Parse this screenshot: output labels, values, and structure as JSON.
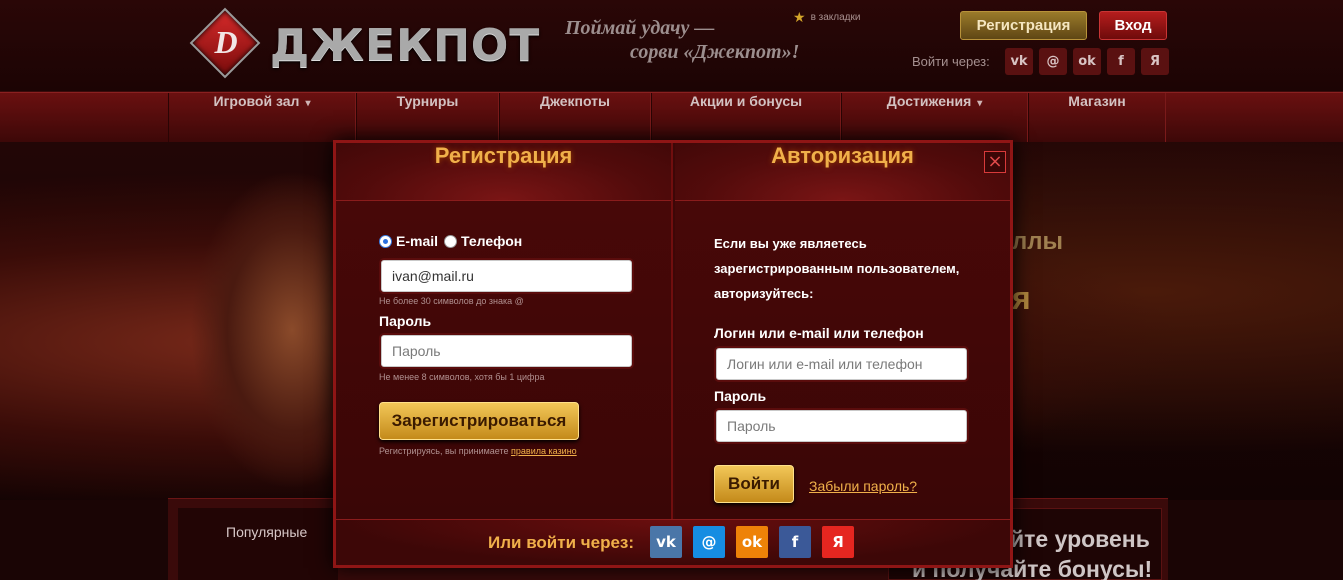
{
  "header": {
    "logo_letter": "D",
    "logo_text": "ДЖЕКПОТ",
    "slogan_line1": "Поймай удачу —",
    "slogan_line2": "сорви «Джекпот»!",
    "bookmark_label": "в закладки",
    "register_label": "Регистрация",
    "login_label": "Вход",
    "enter_via_label": "Войти через:",
    "social": [
      {
        "icon": "vk-icon",
        "glyph": "vk"
      },
      {
        "icon": "mailru-icon",
        "glyph": "@"
      },
      {
        "icon": "odnoklassniki-icon",
        "glyph": "ok"
      },
      {
        "icon": "facebook-icon",
        "glyph": "f"
      },
      {
        "icon": "yandex-icon",
        "glyph": "Я"
      }
    ]
  },
  "nav": {
    "items": [
      {
        "label": "Игровой зал",
        "has_dropdown": true
      },
      {
        "label": "Турниры",
        "has_dropdown": false
      },
      {
        "label": "Джекпоты",
        "has_dropdown": false
      },
      {
        "label": "Акции и бонусы",
        "has_dropdown": false
      },
      {
        "label": "Достижения",
        "has_dropdown": true
      },
      {
        "label": "Магазин",
        "has_dropdown": false
      }
    ]
  },
  "background": {
    "promo_text1": "ллы",
    "promo_text2": "я",
    "popular_label": "Популярные",
    "bonus_line1": "йте уровень",
    "bonus_line2": "и получайте бонусы!"
  },
  "modal": {
    "close_glyph": "×",
    "register": {
      "title": "Регистрация",
      "radio_email": "E-mail",
      "radio_phone": "Телефон",
      "email_value": "ivan@mail.ru",
      "email_hint": "Не более 30 символов до знака @",
      "password_label": "Пароль",
      "password_placeholder": "Пароль",
      "password_hint": "Не менее 8 символов, хотя бы 1 цифра",
      "submit_label": "Зарегистрироваться",
      "terms_text": "Регистрируясь, вы принимаете",
      "terms_link": "правила казино"
    },
    "auth": {
      "title": "Авторизация",
      "intro": "Если вы уже являетесь зарегистрированным пользователем, авторизуйтесь:",
      "login_label": "Логин или e-mail или телефон",
      "login_placeholder": "Логин или e-mail или телефон",
      "password_label": "Пароль",
      "password_placeholder": "Пароль",
      "submit_label": "Войти",
      "forgot_label": "Забыли пароль?"
    },
    "footer": {
      "label": "Или войти через:",
      "social": [
        {
          "icon": "vk-icon",
          "glyph": "vk",
          "color": "#4a76a8"
        },
        {
          "icon": "mailru-icon",
          "glyph": "@",
          "color": "#168de2"
        },
        {
          "icon": "odnoklassniki-icon",
          "glyph": "ok",
          "color": "#ee8208"
        },
        {
          "icon": "facebook-icon",
          "glyph": "f",
          "color": "#3b5998"
        },
        {
          "icon": "yandex-icon",
          "glyph": "Я",
          "color": "#e52620"
        }
      ]
    }
  }
}
